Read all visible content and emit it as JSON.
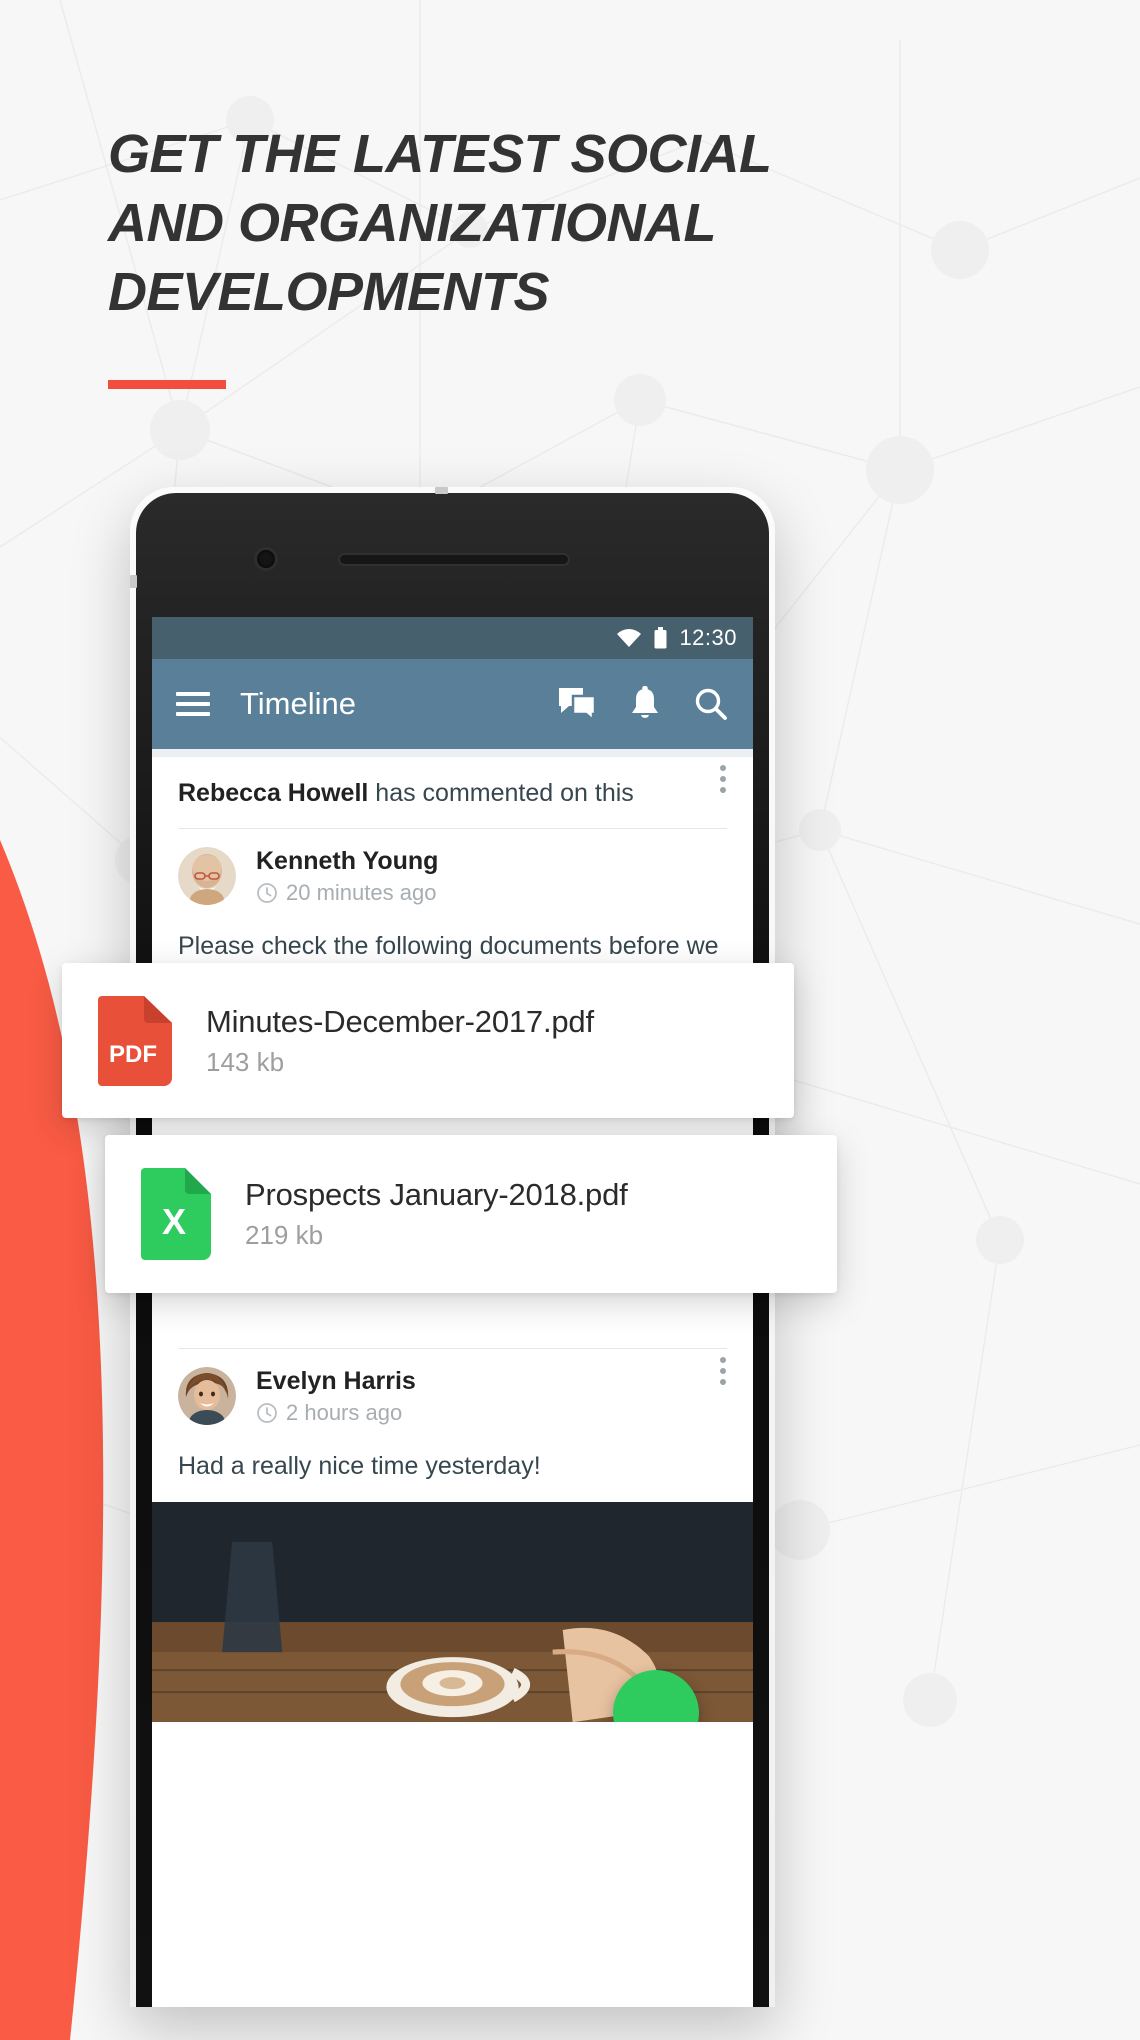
{
  "page": {
    "background_color": "#f7f7f7",
    "accent_color": "#f24e3d"
  },
  "headline": {
    "lines": [
      "GET THE LATEST SOCIAL",
      "AND ORGANIZATIONAL",
      "DEVELOPMENTS"
    ],
    "color": "#333333"
  },
  "phone": {
    "status_bar": {
      "time": "12:30",
      "wifi_icon": "wifi-icon",
      "battery_icon": "battery-icon",
      "background_color": "#46606e"
    },
    "app_bar": {
      "menu_icon": "hamburger-menu-icon",
      "title": "Timeline",
      "actions": [
        {
          "icon": "messages-icon",
          "label": "Messages"
        },
        {
          "icon": "bell-icon",
          "label": "Notifications"
        },
        {
          "icon": "search-icon",
          "label": "Search"
        }
      ],
      "background_color": "#5a8099"
    },
    "feed": {
      "posts": [
        {
          "header_actor": "Rebecca Howell",
          "header_action": " has commented on this",
          "overflow_icon": "kebab-menu-icon",
          "author": "Kenneth Young",
          "time": "20 minutes ago",
          "time_icon": "clock-icon",
          "body": "Please check the following documents before we start our meeting of tomorrow."
        },
        {
          "author": "Evelyn Harris",
          "time": "2 hours ago",
          "time_icon": "clock-icon",
          "overflow_icon": "kebab-menu-icon",
          "body": "Had a really nice time yesterday!"
        }
      ],
      "fab": {
        "icon": "compose-fab-icon",
        "color": "#2ecc5f"
      }
    }
  },
  "attachments": [
    {
      "icon": "pdf-file-icon",
      "icon_label": "PDF",
      "icon_color": "#e8503a",
      "name": "Minutes-December-2017.pdf",
      "size": "143 kb"
    },
    {
      "icon": "excel-file-icon",
      "icon_label": "X",
      "icon_color": "#2ecc5f",
      "name": "Prospects January-2018.pdf",
      "size": "219 kb"
    }
  ]
}
